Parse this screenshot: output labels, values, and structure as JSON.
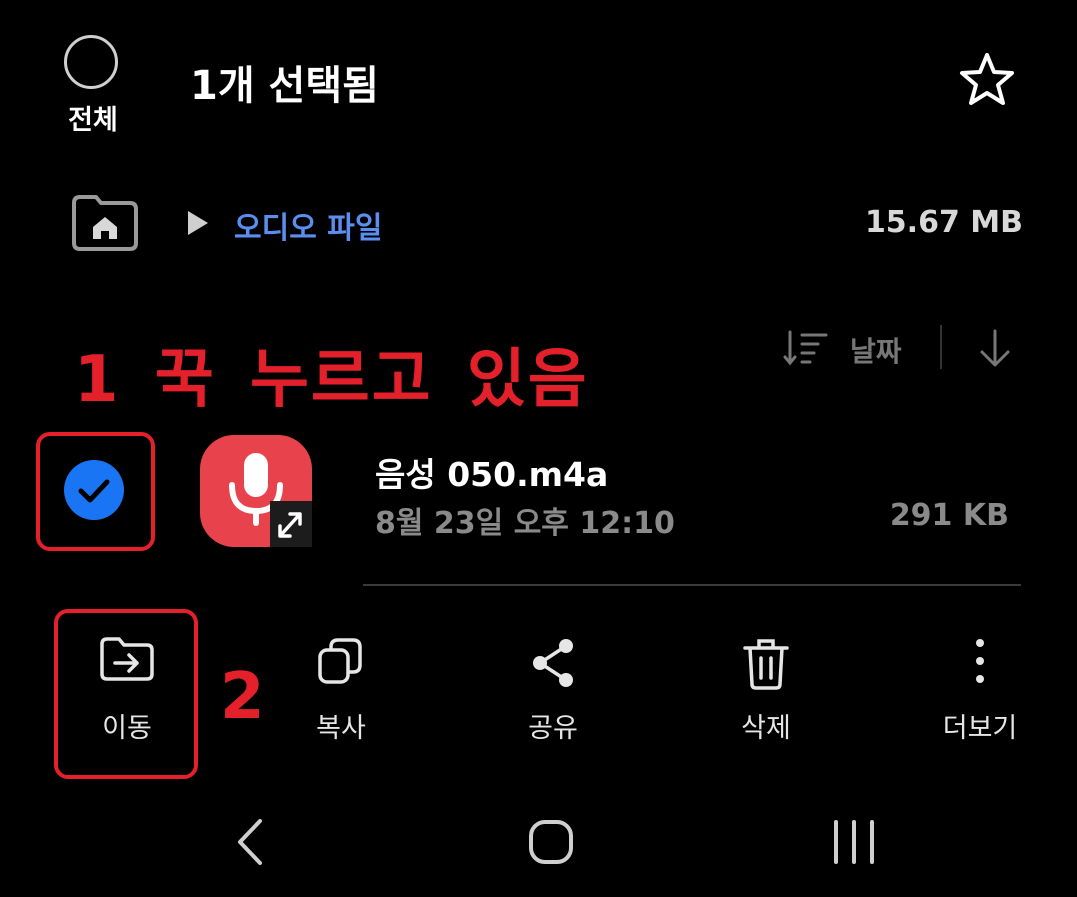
{
  "header": {
    "select_all_label": "전체",
    "title": "1개 선택됨"
  },
  "breadcrumb": {
    "folder": "오디오 파일",
    "storage_size": "15.67 MB"
  },
  "sort": {
    "label": "날짜"
  },
  "annotations": {
    "step1": "1 꾹 누르고 있음",
    "step2": "2",
    "color": "#e4202b"
  },
  "file": {
    "name": "음성 050.m4a",
    "date": "8월 23일 오후 12:10",
    "size": "291 KB",
    "selected": true,
    "icon": "microphone-icon"
  },
  "actions": [
    {
      "label": "이동",
      "icon": "move-folder-icon"
    },
    {
      "label": "복사",
      "icon": "copy-icon"
    },
    {
      "label": "공유",
      "icon": "share-icon"
    },
    {
      "label": "삭제",
      "icon": "trash-icon"
    },
    {
      "label": "더보기",
      "icon": "more-vertical-icon"
    }
  ],
  "colors": {
    "background": "#000000",
    "accent_blue": "#1a75f5",
    "folder_link": "#5a8ff0",
    "recorder_red": "#e8434d"
  }
}
